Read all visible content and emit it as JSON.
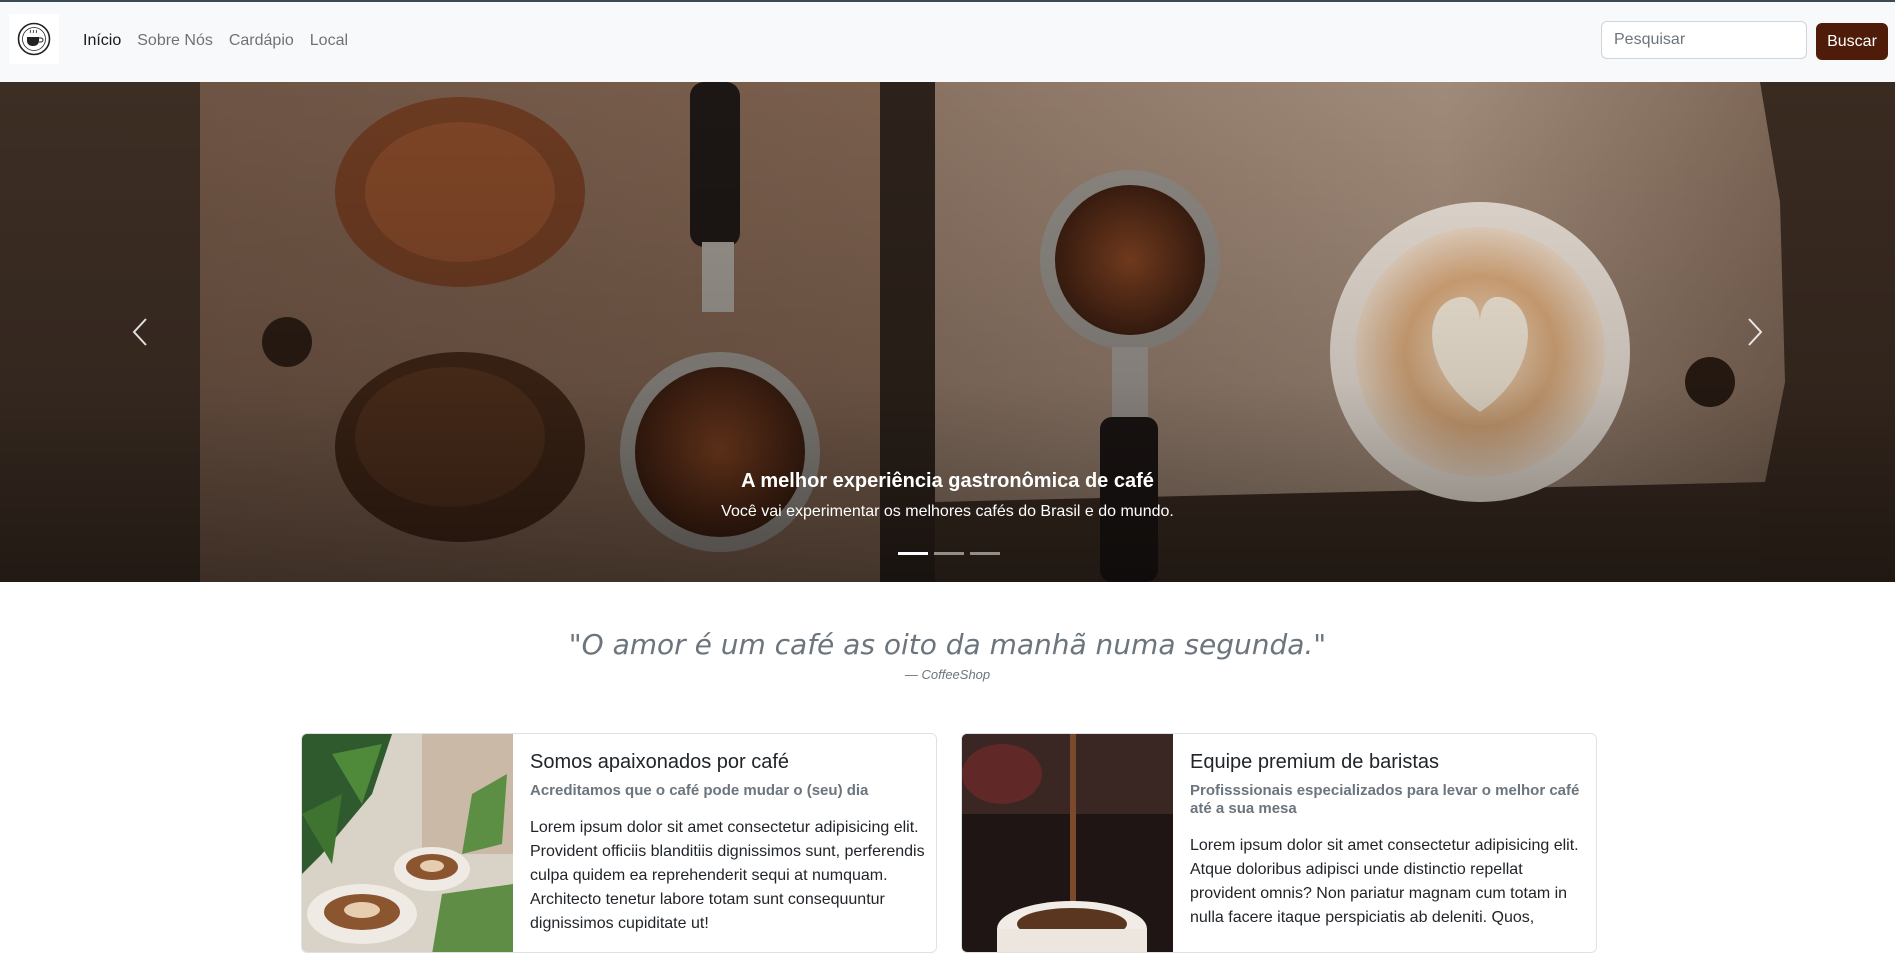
{
  "navbar": {
    "logo_icon": "coffee-logo-icon",
    "links": [
      {
        "label": "Início",
        "active": true
      },
      {
        "label": "Sobre Nós",
        "active": false
      },
      {
        "label": "Cardápio",
        "active": false
      },
      {
        "label": "Local",
        "active": false
      }
    ],
    "search_placeholder": "Pesquisar",
    "search_button": "Buscar"
  },
  "carousel": {
    "title": "A melhor experiência gastronômica de café",
    "text": "Você vai experimentar os melhores cafés do Brasil e do mundo.",
    "slide_count": 3,
    "active_slide": 1,
    "prev_icon": "chevron-left-icon",
    "next_icon": "chevron-right-icon"
  },
  "quote": {
    "text": "\"O amor é um café as oito da manhã numa segunda.\"",
    "author": "— CoffeeShop"
  },
  "cards": [
    {
      "title": "Somos apaixonados por café",
      "subtitle": "Acreditamos que o café pode mudar o (seu) dia",
      "text": "Lorem ipsum dolor sit amet consectetur adipisicing elit. Provident officiis blanditiis dignissimos sunt, perferendis culpa quidem ea reprehenderit sequi at numquam. Architecto tenetur labore totam sunt consequuntur dignissimos cupiditate ut!"
    },
    {
      "title": "Equipe premium de baristas",
      "subtitle": "Profisssionais especializados para levar o melhor café até a sua mesa",
      "text": "Lorem ipsum dolor sit amet consectetur adipisicing elit. Atque doloribus adipisci unde distinctio repellat provident omnis? Non pariatur magnam cum totam in nulla facere itaque perspiciatis ab deleniti. Quos,"
    }
  ],
  "colors": {
    "accent": "#4f1c0a",
    "navbar_bg": "#f8f9fa",
    "muted_text": "#6c757d"
  }
}
